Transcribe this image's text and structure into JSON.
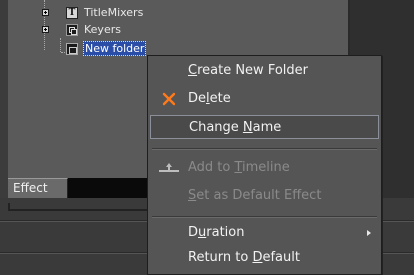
{
  "tree": {
    "items": [
      {
        "label": "TitleMixers",
        "icon": "title-icon"
      },
      {
        "label": "Keyers",
        "icon": "keyer-icon"
      },
      {
        "label": "New folder",
        "icon": "folder-icon",
        "selected": true
      }
    ]
  },
  "tabs": {
    "effect": "Effect"
  },
  "context_menu": {
    "create_new_folder": {
      "pre": "",
      "accel": "C",
      "post": "reate New Folder"
    },
    "delete": {
      "pre": "De",
      "accel": "l",
      "post": "ete",
      "icon": "x-icon",
      "icon_color": "#ff7a1a"
    },
    "change_name": {
      "pre": "Change ",
      "accel": "N",
      "post": "ame"
    },
    "add_to_timeline": {
      "pre": "Add to ",
      "accel": "T",
      "post": "imeline",
      "disabled": true
    },
    "set_as_default_effect": {
      "pre": "",
      "accel": "S",
      "post": "et as Default Effect",
      "disabled": true
    },
    "duration": {
      "pre": "D",
      "accel": "u",
      "post": "ration",
      "has_submenu": true
    },
    "return_to_default": {
      "pre": "Return to ",
      "accel": "D",
      "post": "efault"
    }
  }
}
